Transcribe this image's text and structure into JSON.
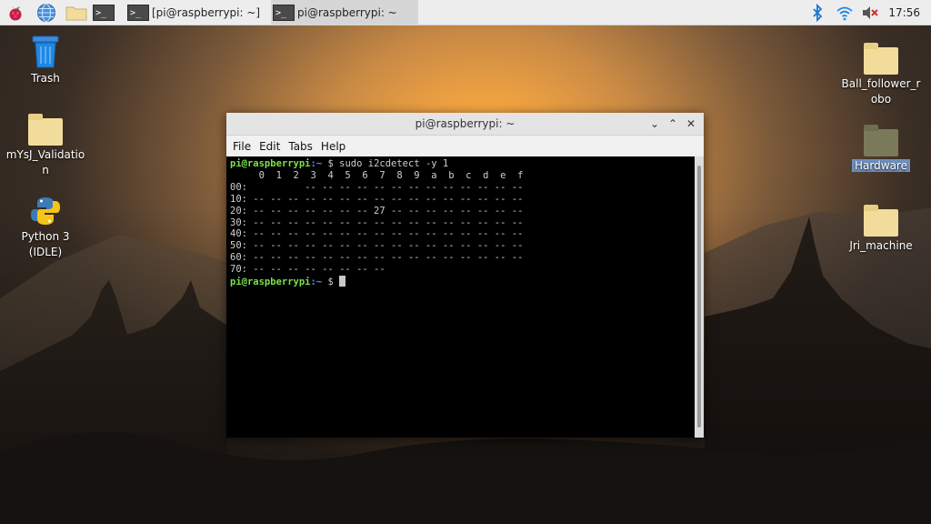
{
  "taskbar": {
    "tasks": [
      {
        "label": "[pi@raspberrypi: ~]"
      },
      {
        "label": "pi@raspberrypi: ~"
      }
    ],
    "term_icon_text": ">_",
    "clock": "17:56"
  },
  "desktop": {
    "icons": [
      {
        "label": "Trash"
      },
      {
        "label": "mYsJ_Validation"
      },
      {
        "label": "Python 3 (IDLE)"
      },
      {
        "label": "Ball_follower_robo"
      },
      {
        "label": "Hardware"
      },
      {
        "label": "Jri_machine"
      }
    ]
  },
  "window": {
    "title": "pi@raspberrypi: ~",
    "controls": {
      "minimize": "⌄",
      "maximize": "⌃",
      "close": "✕"
    },
    "menu": [
      "File",
      "Edit",
      "Tabs",
      "Help"
    ]
  },
  "terminal": {
    "user_host": "pi@raspberrypi",
    "path": ":~",
    "prompt": " $",
    "command": " sudo i2cdetect -y 1",
    "lines": [
      "     0  1  2  3  4  5  6  7  8  9  a  b  c  d  e  f",
      "00:          -- -- -- -- -- -- -- -- -- -- -- -- --",
      "10: -- -- -- -- -- -- -- -- -- -- -- -- -- -- -- --",
      "20: -- -- -- -- -- -- -- 27 -- -- -- -- -- -- -- --",
      "30: -- -- -- -- -- -- -- -- -- -- -- -- -- -- -- --",
      "40: -- -- -- -- -- -- -- -- -- -- -- -- -- -- -- --",
      "50: -- -- -- -- -- -- -- -- -- -- -- -- -- -- -- --",
      "60: -- -- -- -- -- -- -- -- -- -- -- -- -- -- -- --",
      "70: -- -- -- -- -- -- -- --"
    ]
  },
  "icons": {
    "menu": "raspberry-icon",
    "browser": "globe-icon",
    "files": "folder-icon",
    "terminal": "terminal-icon",
    "bluetooth": "bluetooth-icon",
    "wifi": "wifi-icon",
    "volume": "volume-muted-icon"
  },
  "colors": {
    "prompt_user": "#78e34a",
    "prompt_path": "#6a8cff",
    "taskbar": "#ededed"
  }
}
